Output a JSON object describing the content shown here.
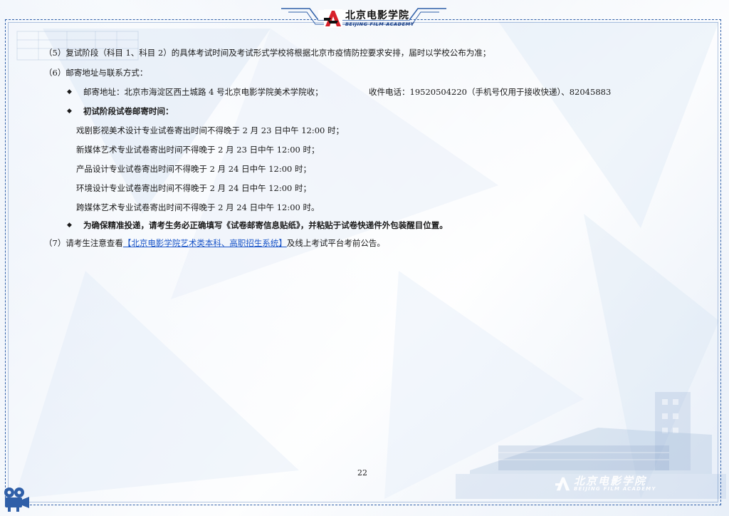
{
  "header": {
    "logo_cn": "北京电影学院",
    "logo_en": "BEIJING FILM ACADEMY"
  },
  "content": {
    "item5": "（5）复试阶段（科目 1、科目 2）的具体考试时间及考试形式学校将根据北京市疫情防控要求安排，届时以学校公布为准；",
    "item6": "（6）邮寄地址与联系方式：",
    "address": "邮寄地址：北京市海淀区西土城路 4 号北京电影学院美术学院收；",
    "phone": "收件电话：19520504220（手机号仅用于接收快递）、82045883",
    "deadline_title": "初试阶段试卷邮寄时间：",
    "deadlines": [
      "戏剧影视美术设计专业试卷寄出时间不得晚于 2 月 23 日中午 12:00 时；",
      "新媒体艺术专业试卷寄出时间不得晚于 2 月 23 日中午 12:00 时；",
      "产品设计专业试卷寄出时间不得晚于 2 月 24 日中午 12:00 时；",
      "环境设计专业试卷寄出时间不得晚于 2 月 24 日中午 12:00 时；",
      "跨媒体艺术专业试卷寄出时间不得晚于 2 月 24 日中午 12:00 时。"
    ],
    "notice": "为确保精准投递，请考生务必正确填写《试卷邮寄信息贴纸》，并粘贴于试卷快递件外包装醒目位置。",
    "item7_prefix": "（7）请考生注意查看",
    "item7_link": "【北京电影学院艺术类本科、高职招生系统】",
    "item7_suffix": "及线上考试平台考前公告。",
    "bullet_glyph": "◆"
  },
  "footer": {
    "page_number": "22",
    "logo_cn": "北京电影学院",
    "logo_en": "BEIJING FILM ACADEMY",
    "camera_icon": "film-camera-icon"
  },
  "colors": {
    "accent": "#2f5fa8",
    "logo_red": "#d8202a",
    "link": "#1a55c8"
  }
}
